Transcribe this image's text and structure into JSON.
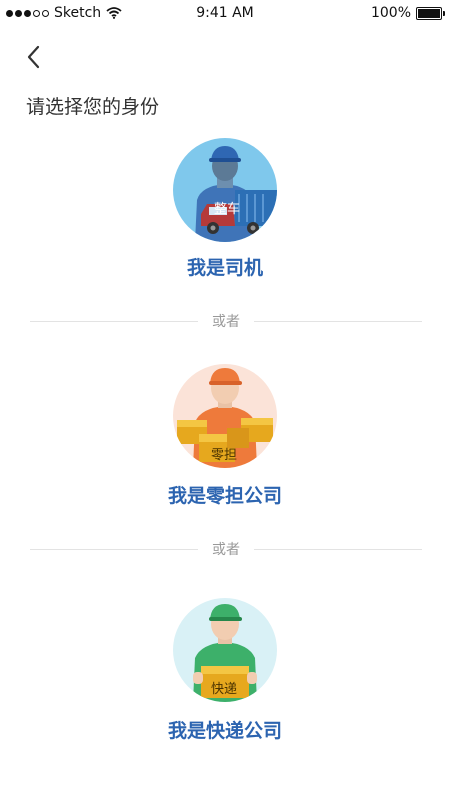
{
  "status_bar": {
    "carrier": "Sketch",
    "time": "9:41 AM",
    "battery": "100%"
  },
  "page": {
    "title": "请选择您的身份"
  },
  "roles": [
    {
      "label": "我是司机",
      "badge": "整车"
    },
    {
      "label": "我是零担公司",
      "badge": "零担"
    },
    {
      "label": "我是快递公司",
      "badge": "快递"
    }
  ],
  "divider_text": "或者",
  "icons": {
    "back": "chevron-left-icon",
    "wifi": "wifi-icon",
    "battery": "battery-icon"
  },
  "colors": {
    "accent": "#2c64b0",
    "divider": "#e3e3e3",
    "divider_text": "#999999"
  }
}
